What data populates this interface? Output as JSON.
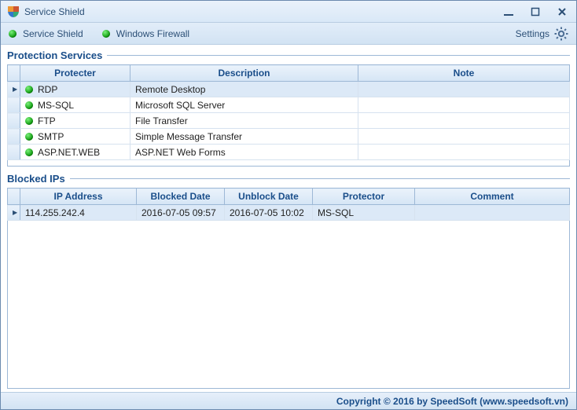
{
  "window": {
    "title": "Service Shield"
  },
  "toolbar": {
    "items": [
      {
        "label": "Service Shield"
      },
      {
        "label": "Windows Firewall"
      }
    ],
    "settings_label": "Settings"
  },
  "protection": {
    "title": "Protection Services",
    "columns": {
      "protecter": "Protecter",
      "description": "Description",
      "note": "Note"
    },
    "rows": [
      {
        "name": "RDP",
        "desc": "Remote Desktop",
        "note": "",
        "selected": true
      },
      {
        "name": "MS-SQL",
        "desc": "Microsoft SQL Server",
        "note": ""
      },
      {
        "name": "FTP",
        "desc": "File Transfer",
        "note": ""
      },
      {
        "name": "SMTP",
        "desc": "Simple Message Transfer",
        "note": ""
      },
      {
        "name": "ASP.NET.WEB",
        "desc": "ASP.NET Web Forms",
        "note": ""
      }
    ]
  },
  "blocked": {
    "title": "Blocked IPs",
    "columns": {
      "ip": "IP Address",
      "blocked": "Blocked Date",
      "unblock": "Unblock Date",
      "protector": "Protector",
      "comment": "Comment"
    },
    "rows": [
      {
        "ip": "114.255.242.4",
        "blocked": "2016-07-05 09:57",
        "unblock": "2016-07-05 10:02",
        "protector": "MS-SQL",
        "comment": "",
        "selected": true
      }
    ]
  },
  "footer": {
    "text": "Copyright © 2016 by SpeedSoft (www.speedsoft.vn)"
  }
}
